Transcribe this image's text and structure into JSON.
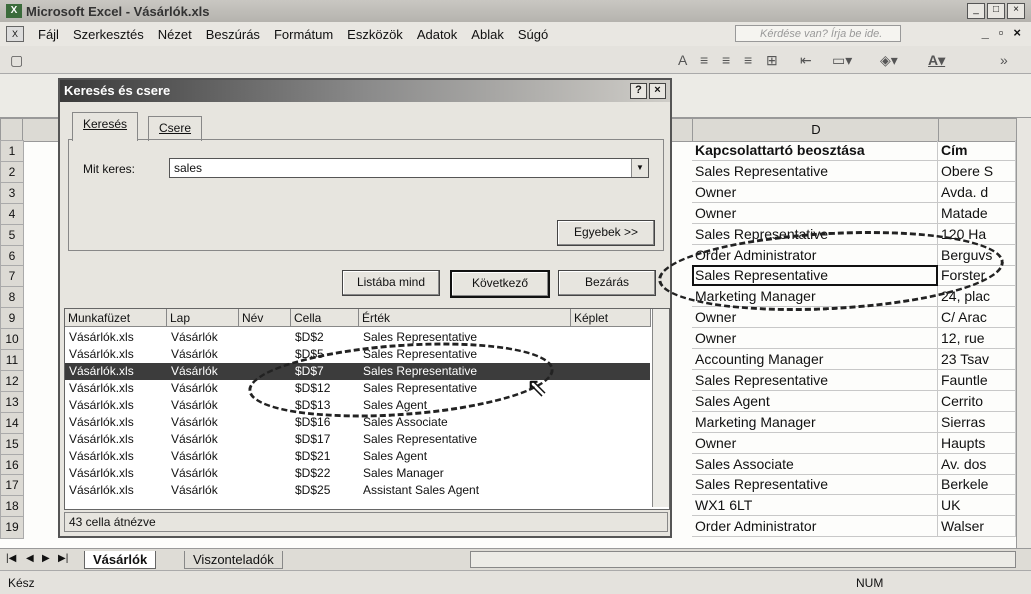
{
  "window": {
    "title": "Microsoft Excel - Vásárlók.xls"
  },
  "menu": [
    "Fájl",
    "Szerkesztés",
    "Nézet",
    "Beszúrás",
    "Formátum",
    "Eszközök",
    "Adatok",
    "Ablak",
    "Súgó"
  ],
  "help_placeholder": "Kérdése van? Írja be ide.",
  "columns": {
    "d": "D"
  },
  "row_numbers": [
    "1",
    "2",
    "3",
    "4",
    "5",
    "6",
    "7",
    "8",
    "9",
    "10",
    "11",
    "12",
    "13",
    "14",
    "15",
    "16",
    "17",
    "18",
    "19"
  ],
  "col_d": [
    "Kapcsolattartó beosztása",
    "Sales Representative",
    "Owner",
    "Owner",
    "Sales Representative",
    "Order Administrator",
    "Sales Representative",
    "Marketing Manager",
    "Owner",
    "Owner",
    "Accounting Manager",
    "Sales Representative",
    "Sales Agent",
    "Marketing Manager",
    "Owner",
    "Sales Associate",
    "Sales Representative",
    "WX1 6LT",
    "Order Administrator"
  ],
  "col_e": [
    "Cím",
    "Obere S",
    "Avda. d",
    "Matade",
    "120 Ha",
    "Berguvs",
    "Forster",
    "24, plac",
    "C/ Arac",
    "12, rue",
    "23 Tsav",
    "Fauntle",
    "Cerrito",
    "Sierras",
    "Haupts",
    "Av. dos",
    "Berkele",
    "UK",
    "Walser"
  ],
  "dialog": {
    "title": "Keresés és csere",
    "tab_find": "Keresés",
    "tab_replace": "Csere",
    "find_label": "Mit keres:",
    "find_value": "sales",
    "options_button": "Egyebek >>",
    "find_all_button": "Listába mind",
    "find_next_button": "Következő",
    "close_button": "Bezárás",
    "result_headers": [
      "Munkafüzet",
      "Lap",
      "Név",
      "Cella",
      "Érték",
      "Képlet"
    ],
    "results": [
      [
        "Vásárlók.xls",
        "Vásárlók",
        "",
        "$D$2",
        "Sales Representative",
        ""
      ],
      [
        "Vásárlók.xls",
        "Vásárlók",
        "",
        "$D$5",
        "Sales Representative",
        ""
      ],
      [
        "Vásárlók.xls",
        "Vásárlók",
        "",
        "$D$7",
        "Sales Representative",
        ""
      ],
      [
        "Vásárlók.xls",
        "Vásárlók",
        "",
        "$D$12",
        "Sales Representative",
        ""
      ],
      [
        "Vásárlók.xls",
        "Vásárlók",
        "",
        "$D$13",
        "Sales Agent",
        ""
      ],
      [
        "Vásárlók.xls",
        "Vásárlók",
        "",
        "$D$16",
        "Sales Associate",
        ""
      ],
      [
        "Vásárlók.xls",
        "Vásárlók",
        "",
        "$D$17",
        "Sales Representative",
        ""
      ],
      [
        "Vásárlók.xls",
        "Vásárlók",
        "",
        "$D$21",
        "Sales Agent",
        ""
      ],
      [
        "Vásárlók.xls",
        "Vásárlók",
        "",
        "$D$22",
        "Sales Manager",
        ""
      ],
      [
        "Vásárlók.xls",
        "Vásárlók",
        "",
        "$D$25",
        "Assistant Sales Agent",
        ""
      ]
    ],
    "selected_result": 2,
    "status": "43 cella átnézve"
  },
  "sheets": [
    "Vásárlók",
    "Viszonteladók"
  ],
  "status": {
    "ready": "Kész",
    "num": "NUM"
  }
}
